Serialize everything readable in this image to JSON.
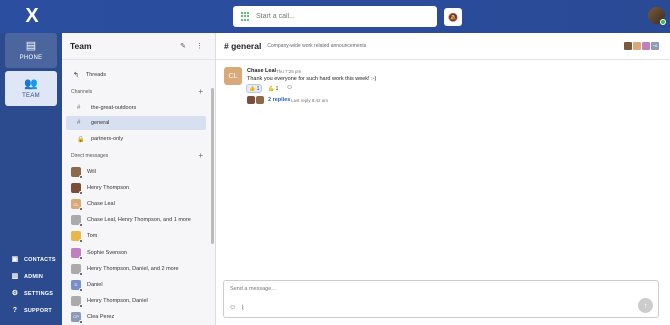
{
  "topbar": {
    "logo_text": "X",
    "call_placeholder": "Start a call...",
    "icons": [
      "dialpad-icon",
      "bell-off-icon",
      "user-avatar"
    ],
    "accent": "#2b4ea0",
    "online_color": "#2fbf4f"
  },
  "leftnav": {
    "phone_label": "PHONE",
    "team_label": "TEAM",
    "contacts_label": "CONTACTS",
    "admin_label": "ADMIN",
    "settings_label": "SETTINGS",
    "support_label": "SUPPORT"
  },
  "team": {
    "title": "Team",
    "threads_label": "Threads",
    "channels_label": "Channels",
    "channels": [
      {
        "name": "the-great-outdoors",
        "icon": "hash-icon"
      },
      {
        "name": "general",
        "icon": "hash-icon",
        "active": true
      },
      {
        "name": "partners-only",
        "icon": "lock-icon"
      }
    ],
    "dm_label": "Direct messages",
    "dms": [
      {
        "name": "Will",
        "color": "#8a6a4a"
      },
      {
        "name": "Henry Thompson",
        "color": "#7a4e3a"
      },
      {
        "name": "Chase Leal",
        "color": "#d9a97a",
        "initials": "CL"
      },
      {
        "name": "Chase Leal, Henry Thompson, and 1 more",
        "color": "#aaaaaa"
      },
      {
        "name": "Tom",
        "color": "#e8b84a"
      },
      {
        "name": "Sophie Svenson",
        "color": "#c080c0"
      },
      {
        "name": "Henry Thompson, Daniel, and 2 more",
        "color": "#aaaaaa"
      },
      {
        "name": "Daniel",
        "color": "#7a8ec8",
        "initials": "D"
      },
      {
        "name": "Henry Thompson, Daniel",
        "color": "#aaaaaa"
      },
      {
        "name": "Clea Perez",
        "color": "#8a9ab8",
        "initials": "CP"
      }
    ]
  },
  "channel": {
    "name": "general",
    "description": "Company-wide work related announcements",
    "members_more": "+8"
  },
  "message": {
    "avatar_initials": "CL",
    "author": "Chase Leal",
    "time": "Thu 7:25 pm",
    "text": "Thank you everyone for such hard work this week! :-)",
    "reactions": [
      {
        "emoji": "👍",
        "count": "1"
      },
      {
        "emoji": "💪",
        "count": "1"
      }
    ],
    "replies": "2 replies",
    "last_reply": "Last reply 8:42 am"
  },
  "composer": {
    "placeholder": "Send a message..."
  }
}
